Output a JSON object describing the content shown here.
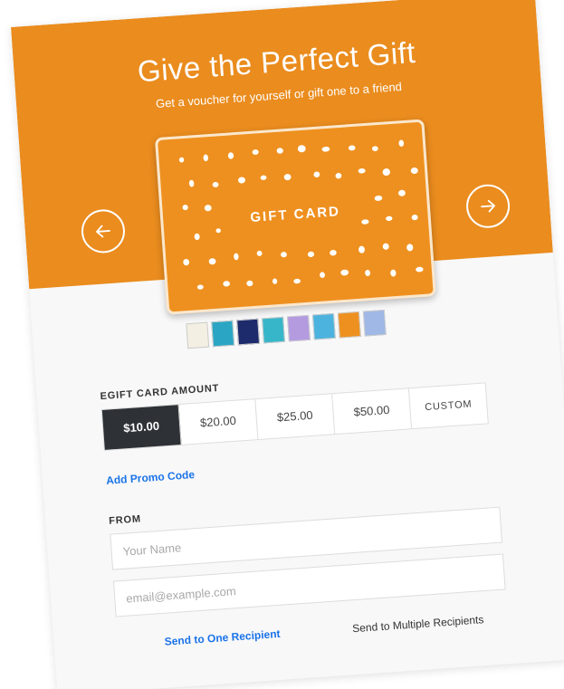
{
  "hero": {
    "title": "Give the Perfect Gift",
    "subtitle": "Get a voucher for yourself or gift one to a friend",
    "background_color": "#ea8c1e"
  },
  "carousel": {
    "card_label": "GIFT CARD",
    "prev_icon": "arrow-left-icon",
    "next_icon": "arrow-right-icon",
    "thumbnails": [
      {
        "name": "thumb-illustration",
        "color": "#f3efe2"
      },
      {
        "name": "thumb-teal-arch",
        "color": "#2aa6c4"
      },
      {
        "name": "thumb-navy-heart",
        "color": "#1d2a6b"
      },
      {
        "name": "thumb-teal-flower",
        "color": "#38b6c9"
      },
      {
        "name": "thumb-purple-pattern",
        "color": "#b49be0"
      },
      {
        "name": "thumb-sky-script",
        "color": "#4cb3de"
      },
      {
        "name": "thumb-orange-dots",
        "color": "#ee901f"
      },
      {
        "name": "thumb-blue-partial",
        "color": "#9fb8e6"
      }
    ]
  },
  "amount": {
    "label": "EGIFT CARD AMOUNT",
    "options": [
      "$10.00",
      "$20.00",
      "$25.00",
      "$50.00",
      "CUSTOM"
    ],
    "selected": "$10.00"
  },
  "promo": {
    "label": "Add Promo Code"
  },
  "from": {
    "label": "FROM",
    "name_placeholder": "Your Name",
    "email_placeholder": "email@example.com"
  },
  "recipients": {
    "one_label": "Send to One Recipient",
    "multiple_label": "Send to Multiple Recipients"
  }
}
